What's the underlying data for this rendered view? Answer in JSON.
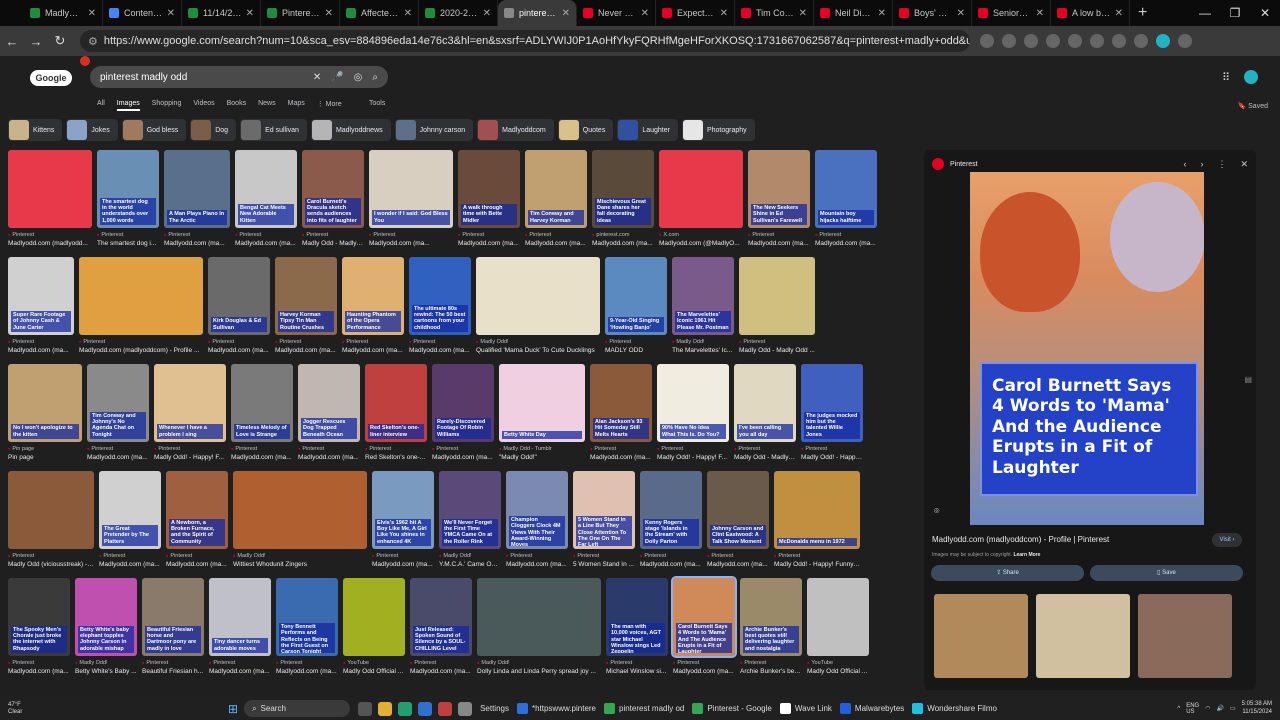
{
  "browser": {
    "tabs": [
      {
        "label": "MadlyOdd 20",
        "color": "#1e8e3e"
      },
      {
        "label": "Content - Wo",
        "color": "#4285f4"
      },
      {
        "label": "11/14/2024",
        "color": "#1e8e3e"
      },
      {
        "label": "Pinterest Risi",
        "color": "#1e8e3e"
      },
      {
        "label": "Affected Plm",
        "color": "#1e8e3e"
      },
      {
        "label": "2020-2024 D",
        "color": "#1e8e3e"
      },
      {
        "label": "pinterest ma",
        "color": "#888888",
        "active": true
      },
      {
        "label": "Never Heard",
        "color": "#e60023"
      },
      {
        "label": "Expect the u",
        "color": "#e60023"
      },
      {
        "label": "Tim Conway",
        "color": "#e60023"
      },
      {
        "label": "Neil Diamon",
        "color": "#e60023"
      },
      {
        "label": "Boys' Choir A",
        "color": "#e60023"
      },
      {
        "label": "Seniors' 'Saf",
        "color": "#e60023"
      },
      {
        "label": "A low bass v",
        "color": "#e60023"
      }
    ],
    "new_tab": "+",
    "url": "https://www.google.com/search?num=10&sca_esv=884896eda14e76c3&hl=en&sxsrf=ADLYWIJ0P1AoHfYkyFQRHfMgeHForXKOSQ:1731667062587&q=pinterest+madly+odd&udm=2&source=univ&fir=Z8xg..."
  },
  "google": {
    "logo": "Google",
    "query": "pinterest madly odd",
    "filters": [
      "All",
      "Images",
      "Shopping",
      "Videos",
      "Books",
      "News",
      "Maps",
      "⋮ More"
    ],
    "tools": "Tools",
    "saved": "Saved"
  },
  "chips": [
    {
      "label": "Kittens",
      "color": "#c9b38a"
    },
    {
      "label": "Jokes",
      "color": "#8aa3c9"
    },
    {
      "label": "God bless",
      "color": "#9f7a5e"
    },
    {
      "label": "Dog",
      "color": "#7b5e4a"
    },
    {
      "label": "Ed sullivan",
      "color": "#6b6b6b"
    },
    {
      "label": "Madlyoddnews",
      "color": "#b5b5b5"
    },
    {
      "label": "Johnny carson",
      "color": "#5e6f8a"
    },
    {
      "label": "Madlyoddcom",
      "color": "#a05050"
    },
    {
      "label": "Quotes",
      "color": "#d8c28a"
    },
    {
      "label": "Laughter",
      "color": "#3050a0"
    },
    {
      "label": "Photography",
      "color": "#e6e6e6"
    }
  ],
  "rows": [
    [
      {
        "w": 84,
        "bg": "#e8394a",
        "cap": "",
        "src": "Pinterest",
        "title": "Madlyodd.com (madlyodd..."
      },
      {
        "w": 62,
        "bg": "#6a8fb5",
        "cap": "The smartest dog in the world understands over 1,000 words",
        "src": "Pinterest",
        "title": "The smartest dog i..."
      },
      {
        "w": 66,
        "bg": "#5a6f8c",
        "cap": "A Man Plays Piano In The Arctic",
        "src": "Pinterest",
        "title": "Madlyodd.com (ma..."
      },
      {
        "w": 62,
        "bg": "#c8c8c8",
        "cap": "Bengal Cat Meets New Adorable Kitten",
        "src": "Pinterest",
        "title": "Madlyodd.com (ma..."
      },
      {
        "w": 62,
        "bg": "#8c5a4a",
        "cap": "Carol Burnett's Dracula sketch sends audiences into fits of laughter",
        "src": "Pinterest",
        "title": "Madly Odd - Madly Odd ad..."
      },
      {
        "w": 84,
        "bg": "#d8cfc0",
        "cap": "I wonder if I said: God Bless You",
        "src": "Pinterest",
        "title": "Madlyodd.com (ma..."
      },
      {
        "w": 62,
        "bg": "#6a4a3a",
        "cap": "A walk through time with Bette Midler",
        "src": "Pinterest",
        "title": "Madlyodd.com (ma..."
      },
      {
        "w": 62,
        "bg": "#c0a070",
        "cap": "Tim Conway and Harvey Korman",
        "src": "Pinterest",
        "title": "Madlyodd.com (ma..."
      },
      {
        "w": 62,
        "bg": "#5a4a3a",
        "cap": "Mischievous Great Dane shares her fall decorating ideas",
        "src": "pinterest.com",
        "title": "Madlyodd.com (ma..."
      },
      {
        "w": 84,
        "bg": "#e8394a",
        "cap": "",
        "src": "X.com",
        "title": "Madlyodd.com (@MadlyO..."
      },
      {
        "w": 62,
        "bg": "#b08a6a",
        "cap": "The New Seekers Shine in Ed Sullivan's Farewell",
        "src": "Pinterest",
        "title": "Madlyodd.com (ma..."
      },
      {
        "w": 62,
        "bg": "#4a70c0",
        "cap": "Mountain boy hijacks halftime",
        "src": "Pinterest",
        "title": "Madlyodd.com (ma..."
      }
    ],
    [
      {
        "w": 66,
        "bg": "#d0d0d0",
        "cap": "Super Rare Footage of Johnny Cash & June Carter",
        "src": "Pinterest",
        "title": "Madlyodd.com (ma..."
      },
      {
        "w": 124,
        "bg": "#e0a040",
        "cap": "",
        "src": "Pinterest",
        "title": "Madlyodd.com (madlyoddcom) - Profile ..."
      },
      {
        "w": 62,
        "bg": "#6a6a6a",
        "cap": "Kirk Douglas & Ed Sullivan",
        "src": "Pinterest",
        "title": "Madlyodd.com (ma..."
      },
      {
        "w": 62,
        "bg": "#8a6a4a",
        "cap": "Harvey Korman Tipsy Tin Man Routine Crushes",
        "src": "Pinterest",
        "title": "Madlyodd.com (ma..."
      },
      {
        "w": 62,
        "bg": "#e0b070",
        "cap": "Haunting Phantom of the Opera Performance",
        "src": "Pinterest",
        "title": "Madlyodd.com (ma..."
      },
      {
        "w": 62,
        "bg": "#3060c0",
        "cap": "The ultimate 80s rewind: The 50 best cartoons from your childhood",
        "src": "Pinterest",
        "title": "Madlyodd.com (ma..."
      },
      {
        "w": 124,
        "bg": "#e8e0c8",
        "cap": "",
        "src": "Madly Odd!",
        "title": "Qualified 'Mama Duck' To Cute Ducklings"
      },
      {
        "w": 62,
        "bg": "#5a8ac0",
        "cap": "9-Year-Old Singing 'Howling Banjo'",
        "src": "Pinterest",
        "title": "MADLY ODD"
      },
      {
        "w": 62,
        "bg": "#7a5a8a",
        "cap": "The Marvelettes' Iconic 1961 Hit Please Mr. Postman",
        "src": "Madly Odd!",
        "title": "The Marvelettes' Ic..."
      },
      {
        "w": 76,
        "bg": "#d0c080",
        "cap": "",
        "src": "Pinterest",
        "title": "Madly Odd - Madly Odd ..."
      }
    ],
    [
      {
        "w": 74,
        "bg": "#c0a070",
        "cap": "No I won't apologize to the kitten",
        "src": "Pin page",
        "title": "Pin page"
      },
      {
        "w": 62,
        "bg": "#8a8a8a",
        "cap": "Tim Conway and Johnny's No Agenda Chat on Tonight",
        "src": "Pinterest",
        "title": "Madlyodd.com (ma..."
      },
      {
        "w": 72,
        "bg": "#e0c090",
        "cap": "Whenever I have a problem I sing",
        "src": "Pinterest",
        "title": "Madly Odd! - Happy! F..."
      },
      {
        "w": 62,
        "bg": "#7a7a7a",
        "cap": "Timeless Melody of Love is Strange",
        "src": "Pinterest",
        "title": "Madlyodd.com (ma..."
      },
      {
        "w": 62,
        "bg": "#c0b8b0",
        "cap": "Jogger Rescues Dog Trapped Beneath Ocean",
        "src": "Pinterest",
        "title": "Madlyodd.com (ma..."
      },
      {
        "w": 62,
        "bg": "#c04040",
        "cap": "Red Skelton's one-liner interview",
        "src": "Pinterest",
        "title": "Red Skelton's one-..."
      },
      {
        "w": 62,
        "bg": "#5a3a6a",
        "cap": "Rarely-Discovered Footage Of Robin Williams",
        "src": "Pinterest",
        "title": "Madlyodd.com (ma..."
      },
      {
        "w": 86,
        "bg": "#f0d0e0",
        "cap": "Betty White Day",
        "src": "Madly Odd - Tumblr",
        "title": "\"Madly Odd!\""
      },
      {
        "w": 62,
        "bg": "#8a5a3a",
        "cap": "Alan Jackson's 93 Hit Someday Still Melts Hearts",
        "src": "Pinterest",
        "title": "Madlyodd.com (ma..."
      },
      {
        "w": 72,
        "bg": "#f0ece0",
        "cap": "90% Have No Idea What This Is. Do You?",
        "src": "Pinterest",
        "title": "Madly Odd! - Happy! F..."
      },
      {
        "w": 62,
        "bg": "#e0d8c0",
        "cap": "I've been calling you all day",
        "src": "Pinterest",
        "title": "Madly Odd - Madly Od..."
      },
      {
        "w": 62,
        "bg": "#4060c0",
        "cap": "The judges mocked him but the talented Willie Jones",
        "src": "Pinterest",
        "title": "Madly Odd! - Happy..."
      }
    ],
    [
      {
        "w": 86,
        "bg": "#8a5a3a",
        "cap": "",
        "src": "Pinterest",
        "title": "Madly Odd (viciousstreak) - P..."
      },
      {
        "w": 62,
        "bg": "#d0d0d0",
        "cap": "The Great Pretender by The Platters",
        "src": "Pinterest",
        "title": "Madlyodd.com (ma..."
      },
      {
        "w": 62,
        "bg": "#a06040",
        "cap": "A Newborn, a Broken Furnace, and the Spirit of Community",
        "src": "Pinterest",
        "title": "Madlyodd.com (ma..."
      },
      {
        "w": 134,
        "bg": "#b06030",
        "cap": "",
        "src": "Madly Odd!",
        "title": "Wittiest Whodunit Zingers"
      },
      {
        "w": 62,
        "bg": "#7a9ac0",
        "cap": "Elvis's 1962 hit A Boy Like Me, A Girl Like You shines in enhanced 4K",
        "src": "Pinterest",
        "title": "Madlyodd.com (ma..."
      },
      {
        "w": 62,
        "bg": "#5a4a7a",
        "cap": "We'll Never Forget the First Time YMCA Came On at the Roller Rink",
        "src": "Madly Odd!",
        "title": "Y.M.C.A.' Came On ..."
      },
      {
        "w": 62,
        "bg": "#7a8ab0",
        "cap": "Champion Cloggers Clock 4M Views With Their Award-Winning Moves",
        "src": "Pinterest",
        "title": "Madlyodd.com (ma..."
      },
      {
        "w": 62,
        "bg": "#e0c0b0",
        "cap": "5 Women Stand in a Line But They Close Attention To The One On The Far Left",
        "src": "Pinterest",
        "title": "5 Women Stand In ..."
      },
      {
        "w": 62,
        "bg": "#5a6a8a",
        "cap": "Kenny Rogers stage 'Islands in the Stream' with Dolly Parton",
        "src": "Pinterest",
        "title": "Madlyodd.com (ma..."
      },
      {
        "w": 62,
        "bg": "#6a5a4a",
        "cap": "Johnny Carson and Clint Eastwood: A Talk Show Moment",
        "src": "Pinterest",
        "title": "Madlyodd.com (ma..."
      },
      {
        "w": 86,
        "bg": "#c09040",
        "cap": "McDonalds menu in 1972",
        "src": "Pinterest",
        "title": "Madly Odd! - Happy! Funny! ..."
      }
    ],
    [
      {
        "w": 62,
        "bg": "#3a3a3a",
        "cap": "The Spooky Men's Chorale just broke the internet with Rhapsody",
        "src": "Pinterest",
        "title": "Madlyodd.com (ma..."
      },
      {
        "w": 62,
        "bg": "#c050b0",
        "cap": "Betty White's baby elephant topples Johnny Carson in adorable mishap",
        "src": "Madly Odd!",
        "title": "Betty White's Baby ..."
      },
      {
        "w": 62,
        "bg": "#8a7a6a",
        "cap": "Beautiful Friesian horse and Dartmoor pony are madly in love",
        "src": "Pinterest",
        "title": "Beautiful Friesian h..."
      },
      {
        "w": 62,
        "bg": "#c0c0c8",
        "cap": "Tiny dancer turns adorable moves",
        "src": "Pinterest",
        "title": "Madlyodd.com (ma..."
      },
      {
        "w": 62,
        "bg": "#3a6ab0",
        "cap": "Tony Bennett Performs and Reflects on Being the First Guest on Carson Tonight",
        "src": "Pinterest",
        "title": "Madlyodd.com (ma..."
      },
      {
        "w": 62,
        "bg": "#a0b020",
        "cap": "",
        "src": "YouTube",
        "title": "Madly Odd Official ..."
      },
      {
        "w": 62,
        "bg": "#4a4a6a",
        "cap": "Just Released: Spoken Sound of Silence by a SOUL-CHILLING Level",
        "src": "Pinterest",
        "title": "Madlyodd.com (ma..."
      },
      {
        "w": 124,
        "bg": "#4a5a5a",
        "cap": "",
        "src": "Madly Odd!",
        "title": "Dolly Linda and Linda Perry spread joy ..."
      },
      {
        "w": 62,
        "bg": "#2a3a6a",
        "cap": "The man with 10,000 voices, AGT star Michael Winslow sings Led Zeppelin",
        "src": "Pinterest",
        "title": "Michael Winslow si..."
      },
      {
        "w": 62,
        "bg": "#d08a5a",
        "cap": "Carol Burnett Says 4 Words to 'Mama' And The Audience Erupts in a Fit of Laughter",
        "src": "Pinterest",
        "title": "Madlyodd.com (ma...",
        "selected": true
      },
      {
        "w": 62,
        "bg": "#9a8a6a",
        "cap": "Archie Bunker's best quotes still delivering laughter and nostalgia",
        "src": "Pinterest",
        "title": "Archie Bunker's bes..."
      },
      {
        "w": 62,
        "bg": "#c0c0c0",
        "cap": "",
        "src": "YouTube",
        "title": "Madly Odd Official ..."
      }
    ]
  ],
  "preview": {
    "site": "Pinterest",
    "banner_text": "Carol Burnett Says 4 Words to 'Mama' And the Audience Erupts in a Fit of Laughter",
    "title": "Madlyodd.com (madlyoddcom) - Profile | Pinterest",
    "visit": "Visit",
    "copyright": "Images may be subject to copyright.",
    "learn_more": "Learn More",
    "share": "Share",
    "save": "Save",
    "related_colors": [
      "#b08a5a",
      "#d0c0a0",
      "#8a6a5a"
    ]
  },
  "taskbar": {
    "temp": "47°F",
    "weather": "Clear",
    "search": "Search",
    "apps": [
      {
        "label": "*httpswww.pintere",
        "color": "#2f6fd8"
      },
      {
        "label": "pinterest madly od",
        "color": "#34a853"
      },
      {
        "label": "Pinterest - Google",
        "color": "#34a853"
      },
      {
        "label": "Wave Link",
        "color": "#ffffff"
      },
      {
        "label": "Malwarebytes",
        "color": "#2060e0"
      },
      {
        "label": "Wondershare Filmo",
        "color": "#20c0e0"
      }
    ],
    "lang": "ENG",
    "region": "US",
    "time": "5:05:38 AM",
    "date": "11/15/2024"
  }
}
